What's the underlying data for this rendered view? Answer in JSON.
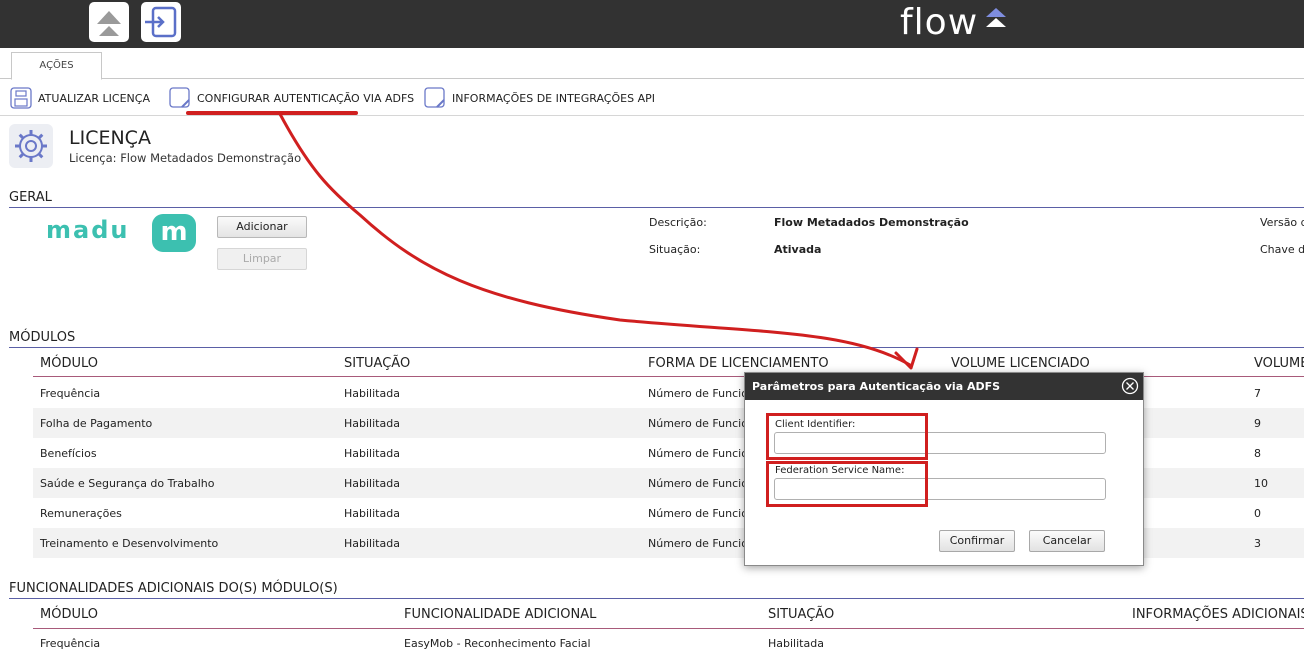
{
  "brand": {
    "logo_text": "flow"
  },
  "tabs": [
    {
      "label": "AÇÕES"
    }
  ],
  "toolbar": {
    "atualizar_label": "ATUALIZAR LICENÇA",
    "configurar_label": "CONFIGURAR AUTENTICAÇÃO VIA ADFS",
    "informacoes_label": "INFORMAÇÕES DE INTEGRAÇÕES API"
  },
  "page": {
    "title": "LICENÇA",
    "subtitle": "Licença: Flow Metadados Demonstração"
  },
  "geral": {
    "heading": "GERAL",
    "logo_text": "madu",
    "logo_mark": "m",
    "adicionar_label": "Adicionar",
    "limpar_label": "Limpar",
    "descricao_label": "Descrição:",
    "descricao_value": "Flow Metadados Demonstração",
    "situacao_label": "Situação:",
    "situacao_value": "Ativada",
    "versao_label": "Versão da",
    "chave_label": "Chave do"
  },
  "modulos": {
    "heading": "MÓDULOS",
    "columns": [
      "MÓDULO",
      "SITUAÇÃO",
      "FORMA DE LICENCIAMENTO",
      "VOLUME LICENCIADO",
      "VOLUME"
    ],
    "rows": [
      {
        "modulo": "Frequência",
        "situacao": "Habilitada",
        "forma": "Número de Funcion",
        "volume": "7"
      },
      {
        "modulo": "Folha de Pagamento",
        "situacao": "Habilitada",
        "forma": "Número de Funcion",
        "volume": "9"
      },
      {
        "modulo": "Benefícios",
        "situacao": "Habilitada",
        "forma": "Número de Funcion",
        "volume": "8"
      },
      {
        "modulo": "Saúde e Segurança do Trabalho",
        "situacao": "Habilitada",
        "forma": "Número de Funcion",
        "volume": "10"
      },
      {
        "modulo": "Remunerações",
        "situacao": "Habilitada",
        "forma": "Número de Funcion",
        "volume": "0"
      },
      {
        "modulo": "Treinamento e Desenvolvimento",
        "situacao": "Habilitada",
        "forma": "Número de Funcion",
        "volume": "3"
      }
    ]
  },
  "funcionalidades": {
    "heading": "FUNCIONALIDADES ADICIONAIS DO(S) MÓDULO(S)",
    "columns": [
      "MÓDULO",
      "FUNCIONALIDADE ADICIONAL",
      "SITUAÇÃO",
      "INFORMAÇÕES ADICIONAIS"
    ],
    "rows": [
      {
        "modulo": "Frequência",
        "funcionalidade": "EasyMob - Reconhecimento Facial",
        "situacao": "Habilitada"
      }
    ]
  },
  "modal": {
    "title": "Parâmetros para Autenticação via ADFS",
    "client_label": "Client Identifier:",
    "client_value": "",
    "federation_label": "Federation Service Name:",
    "federation_value": "",
    "confirm_label": "Confirmar",
    "cancel_label": "Cancelar"
  },
  "colors": {
    "topbar": "#323232",
    "accent": "#5a5fa6",
    "annotation": "#d01f1f",
    "madu": "#3cc0b0"
  }
}
